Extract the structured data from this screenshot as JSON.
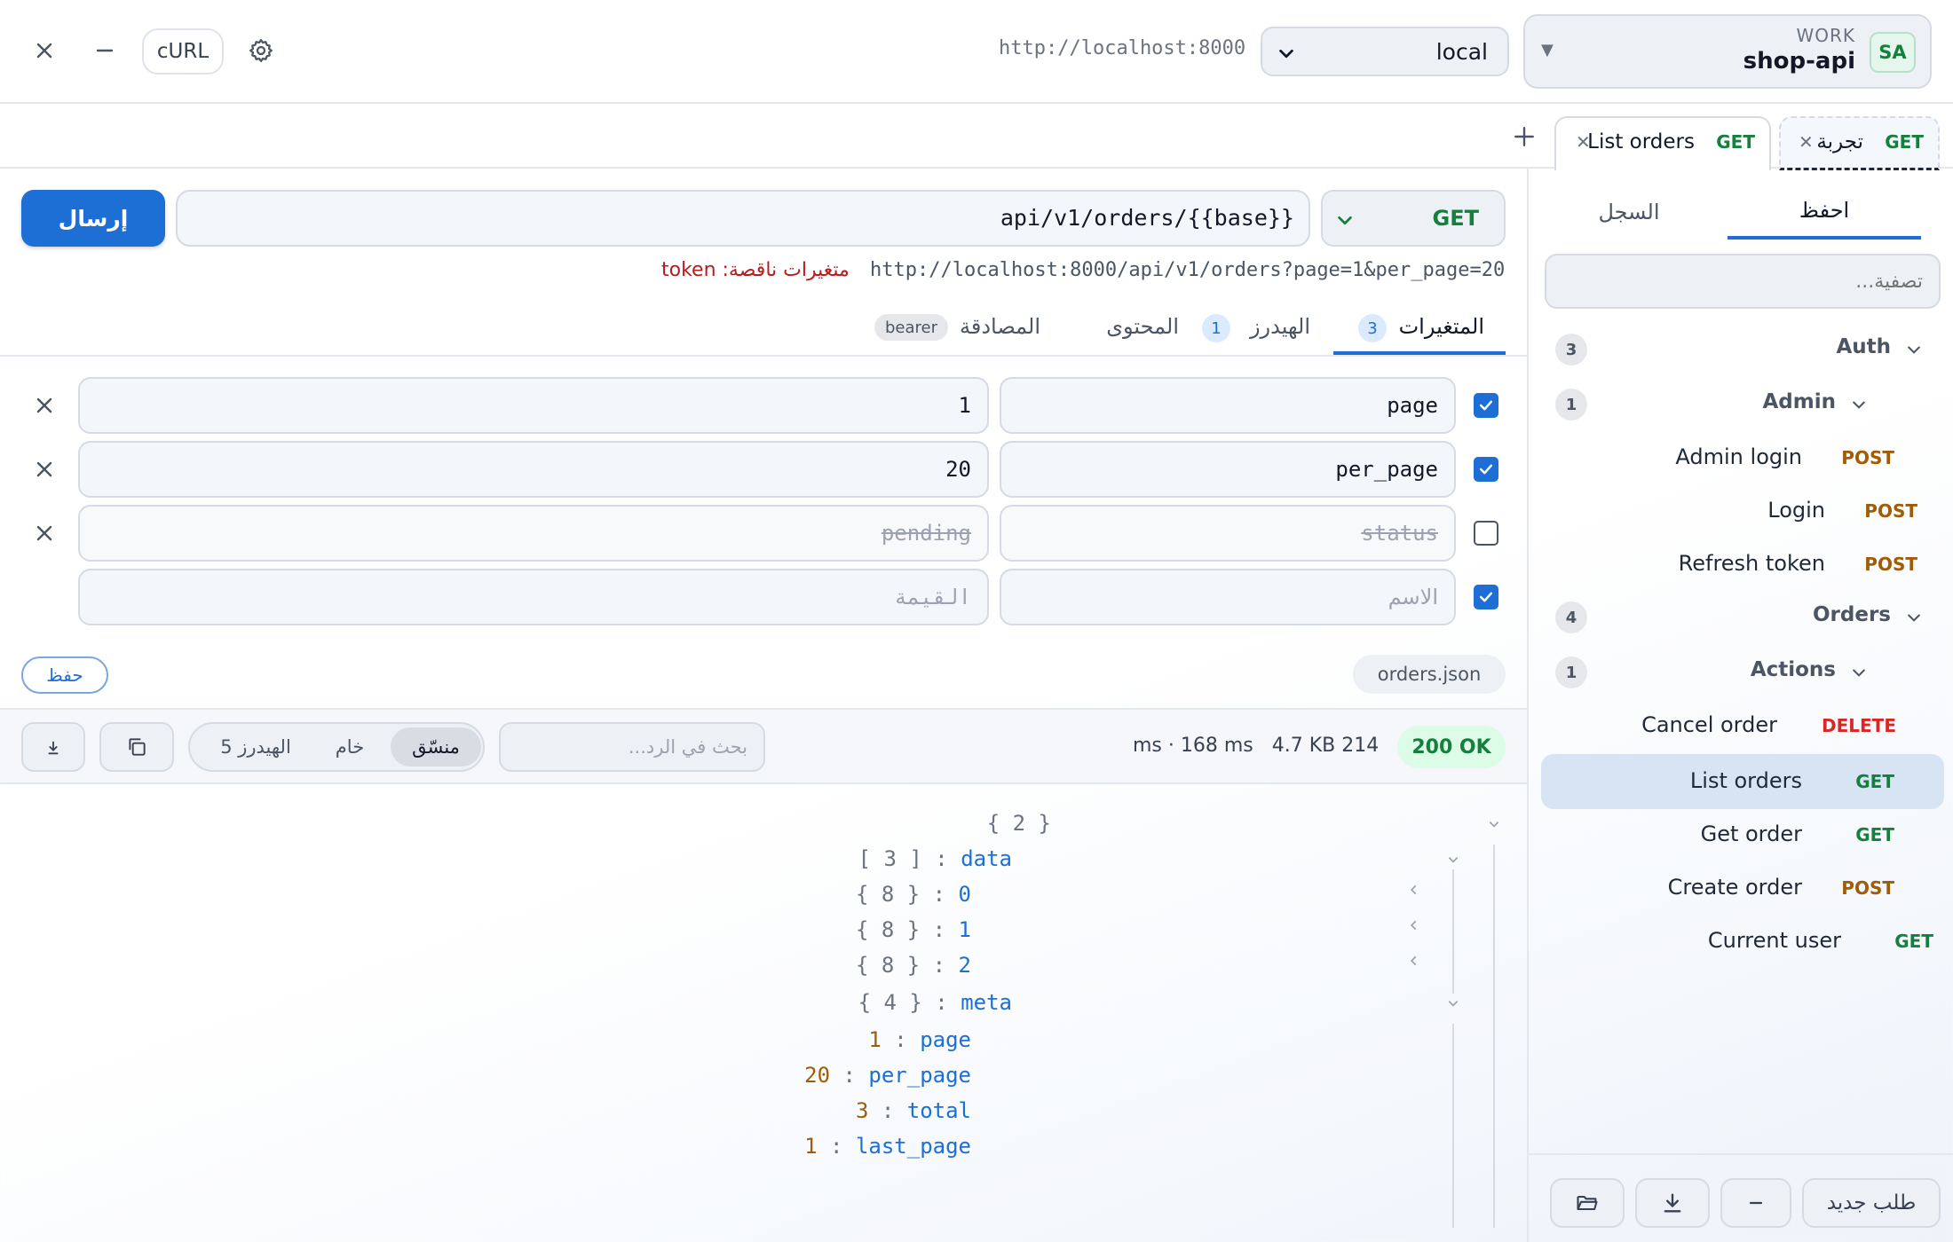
{
  "topbar": {
    "curl_label": "cURL",
    "base_url": "http://localhost:8000",
    "environment": "local",
    "workspace_label": "WORK",
    "workspace_name": "shop-api",
    "workspace_avatar": "SA"
  },
  "tabs": [
    {
      "method": "GET",
      "name": "List orders"
    },
    {
      "method": "GET",
      "name": "تجربة"
    }
  ],
  "sidebar": {
    "tab_saved": "احفظ",
    "tab_history": "السجل",
    "filter_placeholder": "تصفية...",
    "folders": {
      "auth": {
        "name": "Auth",
        "count": "3"
      },
      "admin": {
        "name": "Admin",
        "count": "1"
      },
      "orders": {
        "name": "Orders",
        "count": "4"
      },
      "actions": {
        "name": "Actions",
        "count": "1"
      }
    },
    "requests": [
      {
        "name": "Admin login",
        "method": "POST"
      },
      {
        "name": "Login",
        "method": "POST"
      },
      {
        "name": "Refresh token",
        "method": "POST"
      },
      {
        "name": "Cancel order",
        "method": "DELETE"
      },
      {
        "name": "List orders",
        "method": "GET"
      },
      {
        "name": "Get order",
        "method": "GET"
      },
      {
        "name": "Create order",
        "method": "POST"
      },
      {
        "name": "Current user",
        "method": "GET"
      }
    ],
    "new_request": "طلب جديد"
  },
  "request": {
    "send_label": "إرسال",
    "method": "GET",
    "url": "api/v1/orders/{{base}}",
    "resolved_url": "http://localhost:8000/api/v1/orders?page=1&per_page=20",
    "missing_vars": "متغيرات ناقصة: token",
    "tabs": {
      "params": "المتغيرات",
      "params_count": "3",
      "headers": "الهيدرز",
      "headers_count": "1",
      "body": "المحتوى",
      "auth": "المصادقة",
      "auth_badge": "bearer"
    },
    "params": [
      {
        "key": "page",
        "value": "1",
        "enabled": true
      },
      {
        "key": "per_page",
        "value": "20",
        "enabled": true
      },
      {
        "key": "status",
        "value": "pending",
        "enabled": false
      }
    ],
    "new_param": {
      "key_placeholder": "الاسم",
      "value_placeholder": "القيمة"
    },
    "save_label": "حفظ",
    "body_file": "orders.json"
  },
  "response": {
    "status": "200 OK",
    "time": "214 ms",
    "latency": "· 168 ms",
    "size": "4.7 KB",
    "search_placeholder": "بحث في الرد...",
    "view_pretty": "منسّق",
    "view_raw": "خام",
    "view_headers": "الهيدرز 5",
    "tree": {
      "root": "{ 2 }",
      "data_key": "data",
      "data_count": "[ 3 ]",
      "item0_key": "0",
      "item0_count": "{ 8 }",
      "item1_key": "1",
      "item1_count": "{ 8 }",
      "item2_key": "2",
      "item2_count": "{ 8 }",
      "meta_key": "meta",
      "meta_count": "{ 4 }",
      "page_key": "page",
      "page_val": "1",
      "per_page_key": "per_page",
      "per_page_val": "20",
      "total_key": "total",
      "total_val": "3",
      "last_page_key": "last_page",
      "last_page_val": "1"
    }
  }
}
